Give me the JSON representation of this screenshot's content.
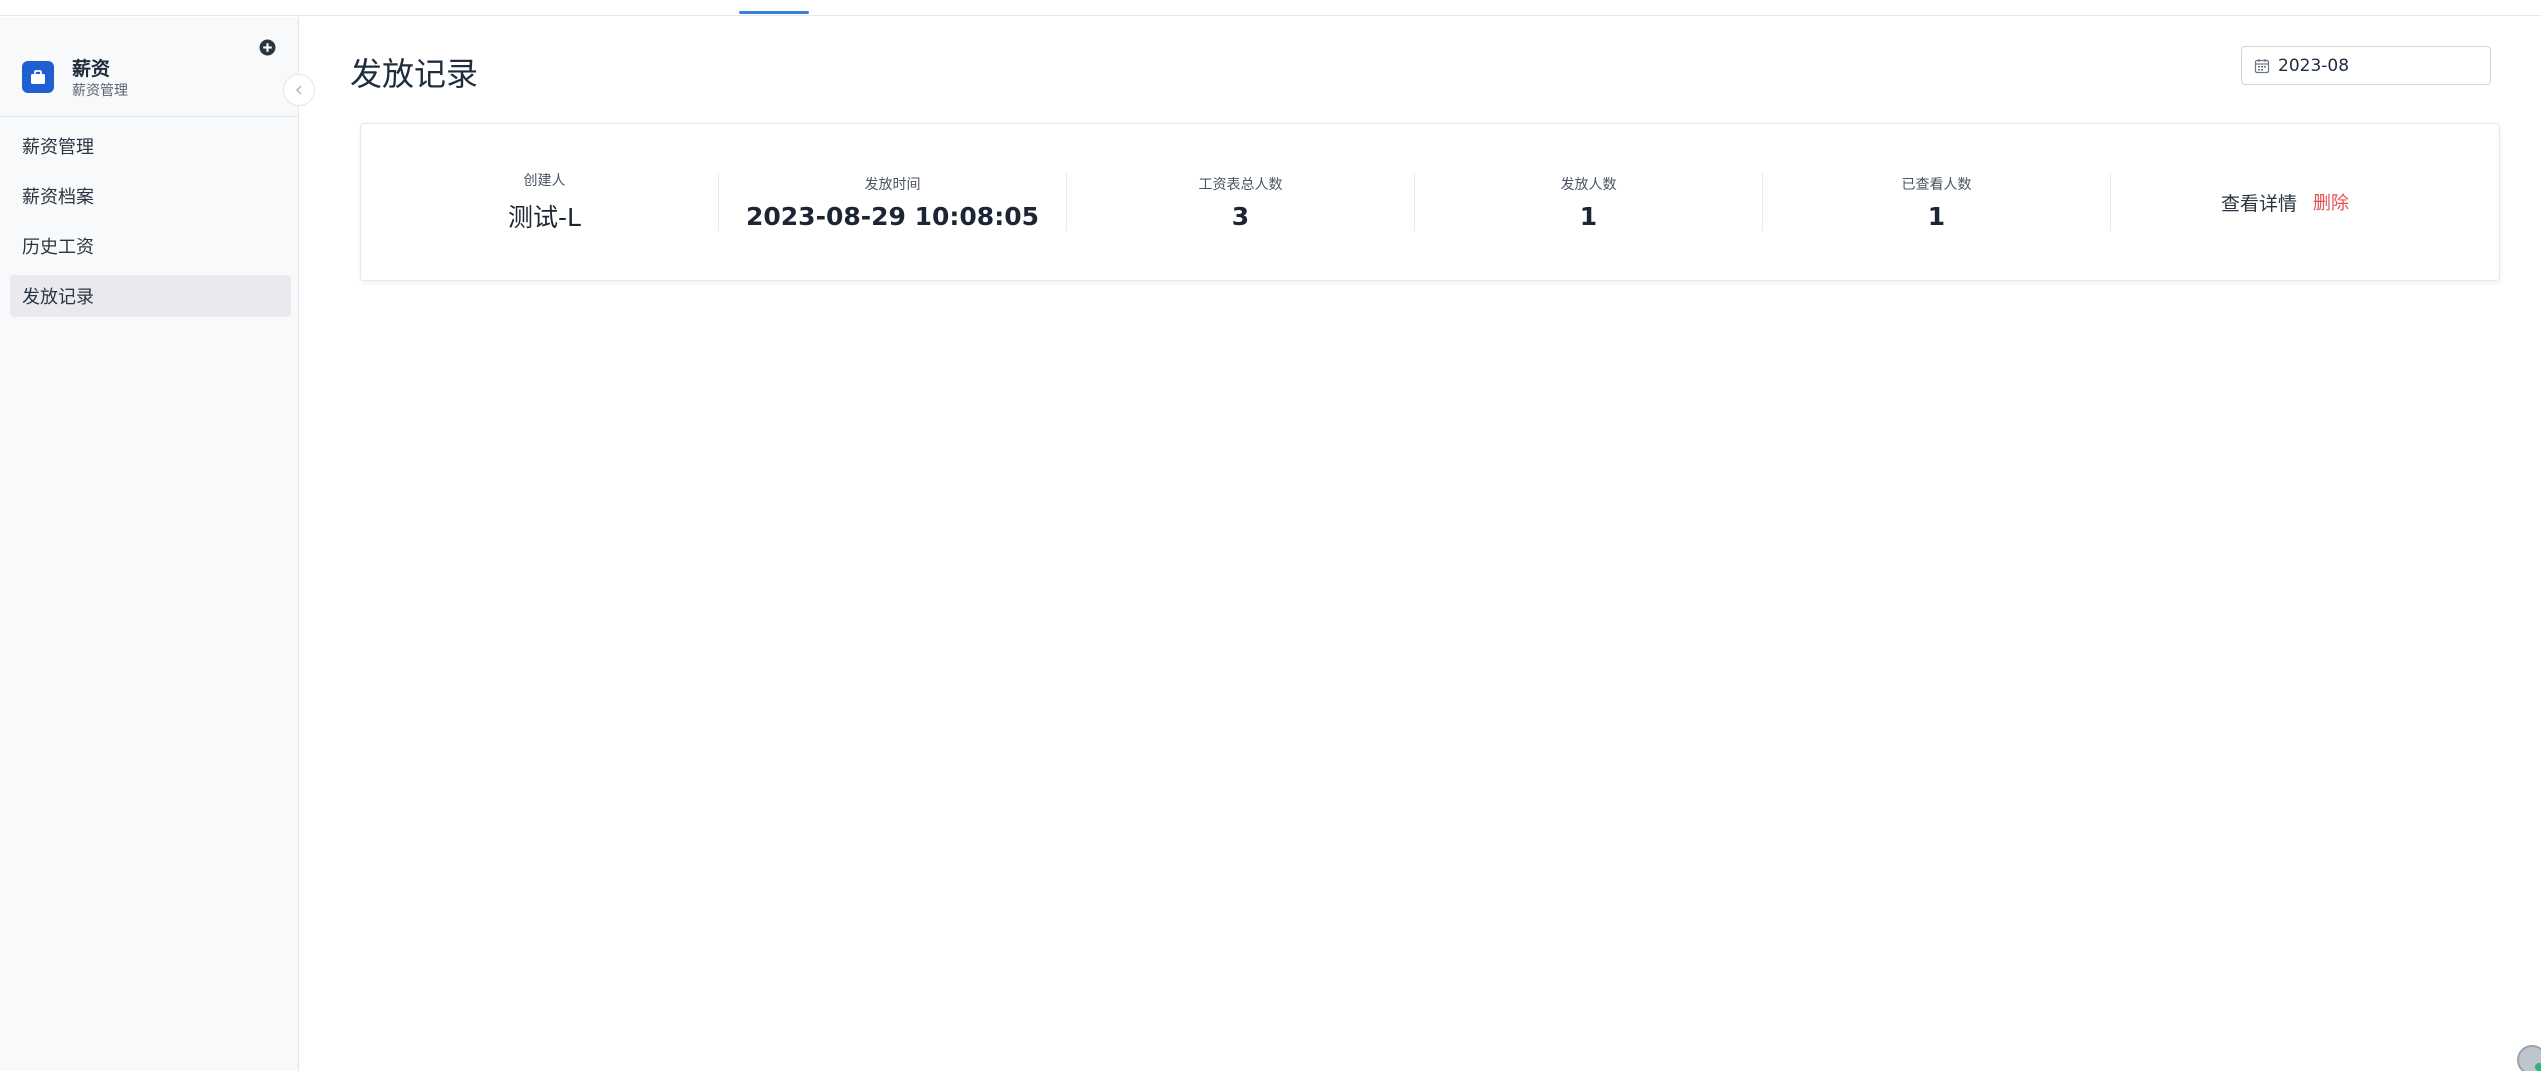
{
  "sidebar": {
    "brand_title": "薪资",
    "brand_subtitle": "薪资管理",
    "items": [
      {
        "label": "薪资管理"
      },
      {
        "label": "薪资档案"
      },
      {
        "label": "历史工资"
      },
      {
        "label": "发放记录"
      }
    ],
    "active_item": "发放记录"
  },
  "main": {
    "page_title": "发放记录",
    "date_filter": "2023-08",
    "record": {
      "creator_label": "创建人",
      "creator_value": "测试-L",
      "time_label": "发放时间",
      "time_value": "2023-08-29 10:08:05",
      "total_label": "工资表总人数",
      "total_value": "3",
      "issued_label": "发放人数",
      "issued_value": "1",
      "viewed_label": "已查看人数",
      "viewed_value": "1",
      "detail_link": "查看详情",
      "delete_link": "删除"
    }
  },
  "colors": {
    "brand": "#1f5fd1",
    "delete": "#e65050",
    "active_tab_line": "#3b7ddd",
    "active_menu_bg": "#e8eaee"
  },
  "icons": [
    "briefcase-icon",
    "plus-circle-icon",
    "chevron-left-icon",
    "calendar-icon"
  ]
}
